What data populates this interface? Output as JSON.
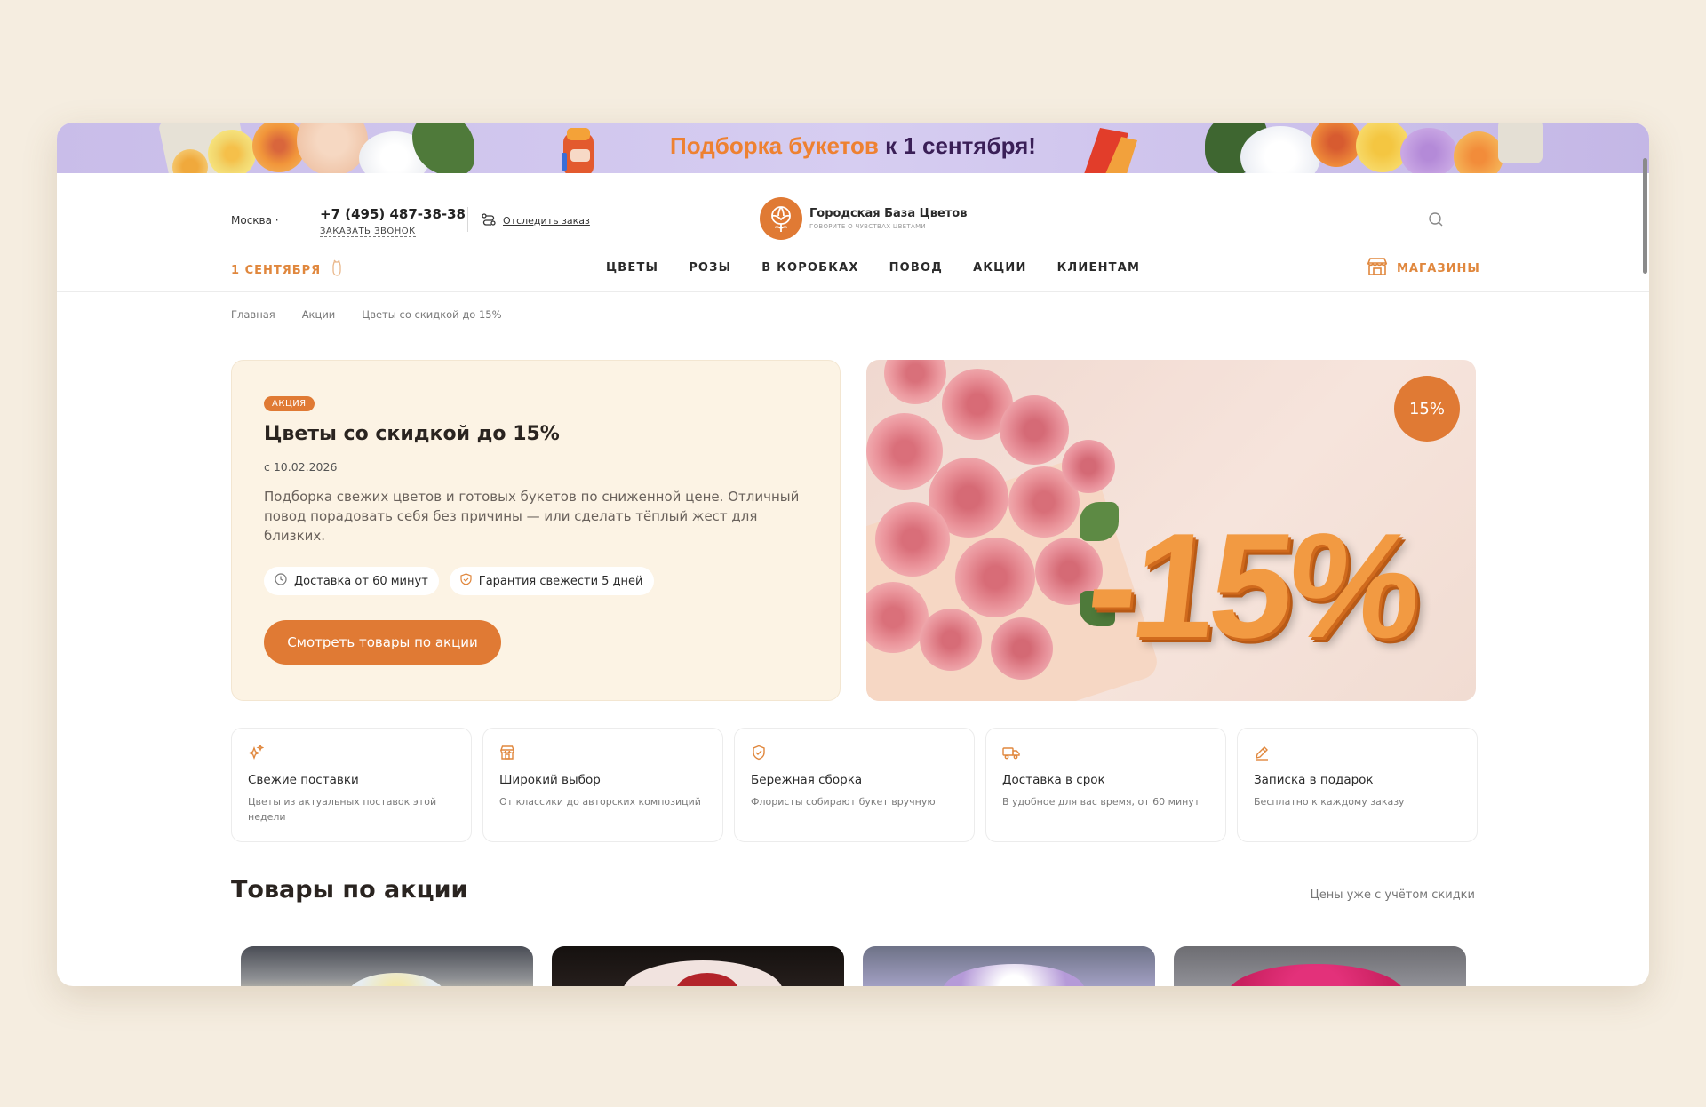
{
  "promo": {
    "highlight": "Подборка букетов",
    "rest": "к 1 сентября!"
  },
  "header": {
    "city": "Москва ·",
    "phone": "+7 (495) 487-38-38",
    "call_label": "ЗАКАЗАТЬ ЗВОНОК",
    "track_label": "Отследить заказ",
    "logo_title": "Городская База Цветов",
    "logo_subtitle": "ГОВОРИТЕ О ЧУВСТВАХ ЦВЕТАМИ"
  },
  "nav": {
    "date_label": "1 СЕНТЯБРЯ",
    "items": [
      "ЦВЕТЫ",
      "РОЗЫ",
      "В КОРОБКАХ",
      "ПОВОД",
      "АКЦИИ",
      "КЛИЕНТАМ"
    ],
    "shops_label": "МАГАЗИНЫ"
  },
  "breadcrumb": [
    "Главная",
    "Акции",
    "Цветы со скидкой до 15%"
  ],
  "hero": {
    "badge": "АКЦИЯ",
    "title": "Цветы со скидкой до 15%",
    "date": "с 10.02.2026",
    "description": "Подборка свежих цветов и готовых букетов по сниженной цене. Отличный повод порадовать себя без причины — или сделать тёплый жест для близких.",
    "chips": [
      "Доставка от 60 минут",
      "Гарантия свежести 5 дней"
    ],
    "button": "Смотреть товары по акции",
    "image_text": "-15%",
    "image_badge": "15%"
  },
  "features": [
    {
      "icon": "sparkles-icon",
      "title": "Свежие поставки",
      "desc": "Цветы из актуальных поставок этой недели"
    },
    {
      "icon": "store-icon",
      "title": "Широкий выбор",
      "desc": "От классики до авторских композиций"
    },
    {
      "icon": "shield-check-icon",
      "title": "Бережная сборка",
      "desc": "Флористы собирают букет вручную"
    },
    {
      "icon": "truck-icon",
      "title": "Доставка в срок",
      "desc": "В удобное для вас время, от 60 минут"
    },
    {
      "icon": "pen-icon",
      "title": "Записка в подарок",
      "desc": "Бесплатно к каждому заказу"
    }
  ],
  "products_section": {
    "title": "Товары по акции",
    "note": "Цены уже с учётом скидки"
  },
  "colors": {
    "accent": "#e07a34",
    "accent_light": "#ee8131",
    "card_bg": "#fcf3e4",
    "page_bg": "#f5ede0",
    "promo_bg": "#c9bde9"
  }
}
